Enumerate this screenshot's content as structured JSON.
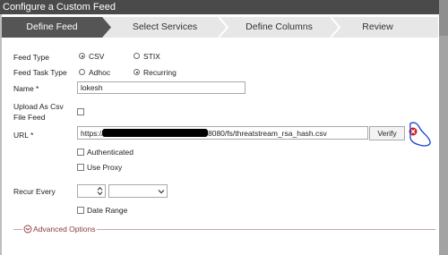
{
  "window": {
    "title": "Configure a Custom Feed"
  },
  "wizard": {
    "steps": [
      {
        "label": "Define Feed",
        "active": true
      },
      {
        "label": "Select Services",
        "active": false
      },
      {
        "label": "Define Columns",
        "active": false
      },
      {
        "label": "Review",
        "active": false
      }
    ]
  },
  "form": {
    "feed_type": {
      "label": "Feed Type",
      "options": [
        "CSV",
        "STIX"
      ],
      "selected": "CSV"
    },
    "feed_task_type": {
      "label": "Feed Task Type",
      "options": [
        "Adhoc",
        "Recurring"
      ],
      "selected": "Recurring"
    },
    "name": {
      "label": "Name *",
      "value": "lokesh"
    },
    "upload_csv": {
      "label_line1": "Upload As Csv",
      "label_line2": "File Feed",
      "checked": false
    },
    "url": {
      "label": "URL *",
      "value_prefix": "https://",
      "value_suffix": "8080/fs/threatstream_rsa_hash.csv",
      "verify_label": "Verify"
    },
    "authenticated": {
      "label": "Authenticated",
      "checked": false
    },
    "use_proxy": {
      "label": "Use Proxy",
      "checked": false
    },
    "recur_every": {
      "label": "Recur Every",
      "value": "",
      "unit": ""
    },
    "date_range": {
      "label": "Date Range",
      "checked": false
    },
    "advanced_options": {
      "label": "Advanced Options"
    }
  },
  "colors": {
    "active_step": "#555555",
    "inactive_step": "#e7e7e7",
    "error_icon": "#cc1f1f",
    "annotation": "#1a3fd1"
  }
}
